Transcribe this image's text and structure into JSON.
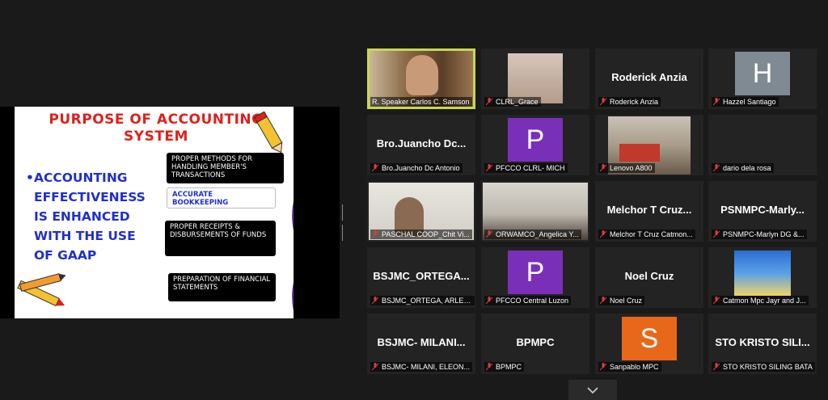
{
  "slide": {
    "title_line1": "PURPOSE OF ACCOUNTING",
    "title_line2": "SYSTEM",
    "bullet": "•",
    "bullet_lines": [
      "ACCOUNTING",
      "EFFECTIVENESS",
      "IS ENHANCED",
      "WITH THE USE",
      "OF GAAP"
    ],
    "box1": "PROPER METHODS FOR HANDLING MEMBER'S TRANSACTIONS",
    "box2": "ACCURATE BOOKKEEPING",
    "box3": "PROPER RECEIPTS & DISBURSEMENTS OF FUNDS",
    "box4": "PREPARATION OF FINANCIAL STATEMENTS"
  },
  "colors": {
    "active_speaker": "#c7d84e",
    "muted_mic": "#e03a3a",
    "avatar_purple": "#7a2fb8",
    "avatar_orange": "#e8681a",
    "avatar_gray": "#7f8a92"
  },
  "participants": [
    {
      "label": "R. Speaker Carlos C. Samson",
      "muted": false,
      "video": true
    },
    {
      "label": "CLRL_Grace",
      "muted": true,
      "video": true
    },
    {
      "name": "Roderick Anzia",
      "label": "Roderick Anzia",
      "muted": true
    },
    {
      "avatar": "H",
      "label": "Hazzel Santiago",
      "muted": true
    },
    {
      "name": "Bro.Juancho Dc...",
      "label": "Bro.Juancho Dc Antonio",
      "muted": true
    },
    {
      "avatar": "P",
      "label": "PFCCO CLRL- MICH",
      "muted": true
    },
    {
      "label": "Lenovo A800",
      "muted": true,
      "video": true
    },
    {
      "label": "dario dela rosa",
      "muted": true
    },
    {
      "label": "PASCHAL COOP_Chit Vi...",
      "muted": true,
      "video": true
    },
    {
      "label": "ORWAMCO_Angelica Y...",
      "muted": true,
      "video": true
    },
    {
      "name": "Melchor T Cruz...",
      "label": "Melchor T Cruz Catmon...",
      "muted": true
    },
    {
      "name": "PSNMPC-Marly...",
      "label": "PSNMPC-Marlyn DG &...",
      "muted": true
    },
    {
      "name": "BSJMC_ORTEGA...",
      "label": "BSJMC_ORTEGA, ARLEN...",
      "muted": true
    },
    {
      "avatar": "P",
      "label": "PFCCO Central Luzon",
      "muted": true
    },
    {
      "name": "Noel Cruz",
      "label": "Noel Cruz",
      "muted": true
    },
    {
      "label": "Catmon Mpc Jayr and J...",
      "muted": true,
      "video": true
    },
    {
      "name": "BSJMC- MILANI...",
      "label": "BSJMC- MILANI, ELEON...",
      "muted": true
    },
    {
      "name": "BPMPC",
      "label": "BPMPC",
      "muted": true
    },
    {
      "avatar": "S",
      "label": "Sanpablo MPC",
      "muted": true
    },
    {
      "name": "STO KRISTO SILI...",
      "label": "STO KRISTO SILING BATA",
      "muted": true
    }
  ],
  "icons": {
    "mic_muted": "mic-muted-icon",
    "chevron": "chevron-down-icon"
  }
}
